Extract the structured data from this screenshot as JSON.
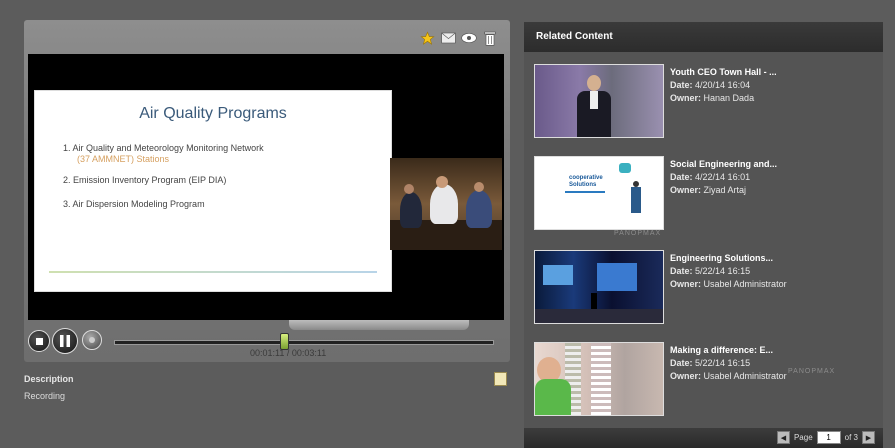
{
  "player": {
    "toolbar_icons": [
      "star-icon",
      "mail-icon",
      "embed-icon",
      "trash-icon"
    ],
    "slide": {
      "title": "Air Quality Programs",
      "items": [
        "1.  Air Quality and Meteorology Monitoring Network",
        "(37 AMMNET) Stations",
        "2.  Emission Inventory Program (EIP DIA)",
        "3.  Air Dispersion Modeling Program"
      ]
    },
    "progress": 0.45,
    "timecode": "00:01:11 / 00:03:11"
  },
  "description": {
    "label": "Description",
    "text": "Recording"
  },
  "related": {
    "header": "Related Content",
    "date_label": "Date:",
    "owner_label": "Owner:",
    "watermark": "PANOPMAX",
    "items": [
      {
        "title": "Youth CEO Town Hall - ...",
        "date": "4/20/14 16:04",
        "owner": "Hanan Dada"
      },
      {
        "title": "Social Engineering and...",
        "date": "4/22/14 16:01",
        "owner": "Ziyad Artaj"
      },
      {
        "title": "Engineering Solutions...",
        "date": "5/22/14 16:15",
        "owner": "Usabel Administrator"
      },
      {
        "title": "Making a difference: E...",
        "date": "5/22/14 16:15",
        "owner": "Usabel Administrator"
      }
    ],
    "pager": {
      "page_label": "Page",
      "current_page": "1",
      "of_label": "of 3"
    }
  },
  "colors": {
    "accent_thumb": "#b6d85a",
    "header_bg": "#2c2c2c"
  }
}
